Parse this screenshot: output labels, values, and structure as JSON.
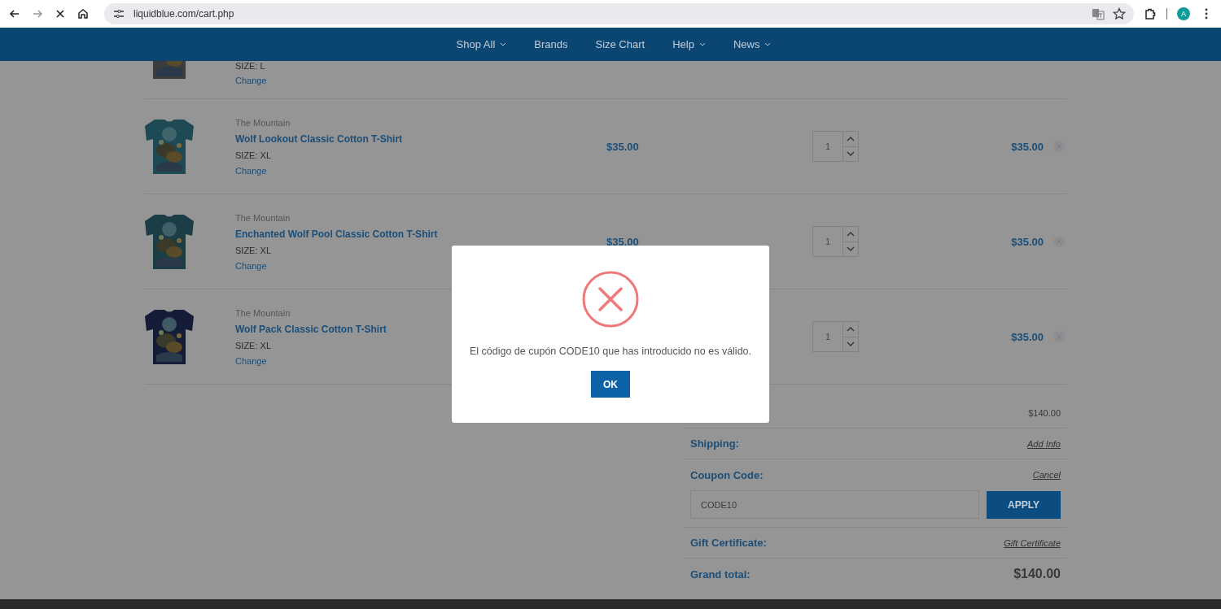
{
  "browser": {
    "url": "liquidblue.com/cart.php",
    "avatar": "A"
  },
  "nav": [
    {
      "label": "Shop All",
      "has_menu": true
    },
    {
      "label": "Brands",
      "has_menu": false
    },
    {
      "label": "Size Chart",
      "has_menu": false
    },
    {
      "label": "Help",
      "has_menu": true
    },
    {
      "label": "News",
      "has_menu": true
    }
  ],
  "partial_item": {
    "size": "SIZE: L",
    "change": "Change"
  },
  "items": [
    {
      "brand": "The Mountain",
      "name": "Wolf Lookout Classic Cotton T-Shirt",
      "size": "SIZE: XL",
      "change": "Change",
      "price": "$35.00",
      "qty": "1",
      "total": "$35.00"
    },
    {
      "brand": "The Mountain",
      "name": "Enchanted Wolf Pool Classic Cotton T-Shirt",
      "size": "SIZE: XL",
      "change": "Change",
      "price": "$35.00",
      "qty": "1",
      "total": "$35.00"
    },
    {
      "brand": "The Mountain",
      "name": "Wolf Pack Classic Cotton T-Shirt",
      "size": "SIZE: XL",
      "change": "Change",
      "qty": "1",
      "total": "$35.00"
    }
  ],
  "summary": {
    "subtotal": "$140.00",
    "shipping_label": "Shipping:",
    "shipping_link": "Add Info",
    "coupon_label": "Coupon Code:",
    "coupon_link": "Cancel",
    "coupon_value": "CODE10",
    "apply": "APPLY",
    "gift_label": "Gift Certificate:",
    "gift_link": "Gift Certificate",
    "grand_label": "Grand total:",
    "grand_value": "$140.00"
  },
  "dialog": {
    "message": "El código de cupón CODE10 que has introducido no es válido.",
    "button": "OK"
  }
}
